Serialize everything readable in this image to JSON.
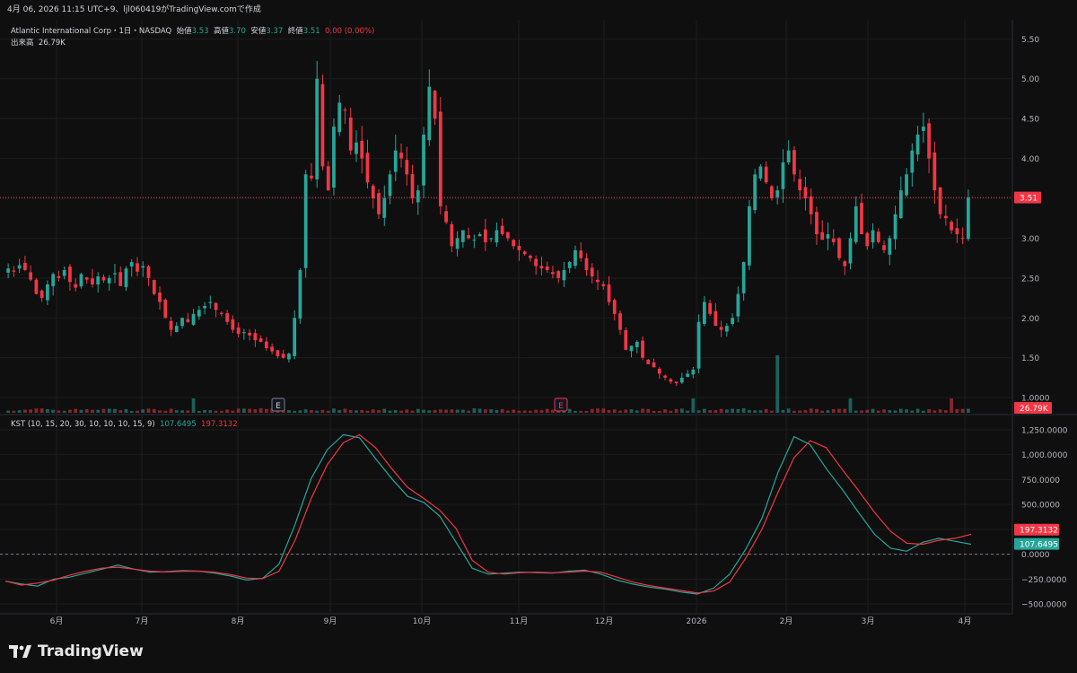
{
  "header": {
    "timestamp": "4月 06, 2026 11:15 UTC+9、ljl060419がTradingView.comで作成"
  },
  "legend": {
    "symbol": "Atlantic International Corp・1日・NASDAQ",
    "open_label": "始値",
    "open": "3.53",
    "high_label": "高値",
    "high": "3.70",
    "low_label": "安値",
    "low": "3.37",
    "close_label": "終値",
    "close": "3.51",
    "change": "0.00 (0.00%)",
    "volume_label": "出来高",
    "volume": "26.79K"
  },
  "kst": {
    "label": "KST (10, 15, 20, 30, 10, 10, 10, 15, 9)",
    "kst_value": "107.6495",
    "signal_value": "197.3132"
  },
  "colors": {
    "up": "#26a69a",
    "down": "#f23645",
    "kst_line": "#26a69a",
    "signal_line": "#f23645",
    "background": "#0f0f0f",
    "grid": "#1c1c1c"
  },
  "price_axis": {
    "ticks": [
      "5.50",
      "5.00",
      "4.50",
      "4.00",
      "3.50",
      "3.00",
      "2.50",
      "2.00",
      "1.50",
      "1.0000"
    ],
    "values": [
      5.5,
      5.0,
      4.5,
      4.0,
      3.5,
      3.0,
      2.5,
      2.0,
      1.5,
      1.0
    ],
    "last_price_badge": "3.51",
    "volume_badge": "26.79K"
  },
  "kst_axis": {
    "ticks": [
      "1,250.0000",
      "1,000.0000",
      "750.0000",
      "500.0000",
      "250.0000",
      "0.0000",
      "−250.0000",
      "−500.0000"
    ],
    "values": [
      1250,
      1000,
      750,
      500,
      250,
      0,
      -250,
      -500
    ],
    "signal_badge": "197.3132",
    "kst_badge": "107.6495"
  },
  "time_axis": {
    "labels": [
      "6月",
      "7月",
      "8月",
      "9月",
      "10月",
      "11月",
      "12月",
      "2026",
      "2月",
      "3月",
      "4月"
    ]
  },
  "events": [
    "E",
    "E"
  ],
  "footer": {
    "brand": "TradingView"
  },
  "chart_data": [
    {
      "type": "candlestick",
      "title": "Atlantic International Corp・1日・NASDAQ",
      "ylim": [
        0.9,
        5.65
      ],
      "close_series": [
        2.62,
        2.58,
        2.66,
        2.6,
        2.48,
        2.3,
        2.25,
        2.42,
        2.55,
        2.5,
        2.6,
        2.45,
        2.38,
        2.55,
        2.48,
        2.42,
        2.52,
        2.47,
        2.5,
        2.56,
        2.4,
        2.62,
        2.7,
        2.58,
        2.65,
        2.5,
        2.3,
        2.2,
        2.0,
        1.85,
        1.9,
        2.0,
        1.95,
        2.05,
        2.1,
        2.15,
        2.2,
        2.1,
        2.05,
        1.95,
        1.85,
        1.8,
        1.82,
        1.78,
        1.72,
        1.7,
        1.62,
        1.58,
        1.52,
        1.5,
        1.55,
        2.0,
        2.6,
        3.8,
        3.75,
        5.0,
        3.9,
        3.6,
        4.4,
        4.7,
        4.6,
        4.1,
        4.2,
        4.0,
        3.7,
        3.5,
        3.3,
        3.5,
        3.8,
        4.1,
        4.0,
        3.8,
        3.5,
        3.6,
        4.3,
        4.9,
        4.5,
        3.4,
        3.2,
        2.9,
        3.0,
        3.1,
        3.0,
        2.98,
        3.05,
        2.95,
        3.0,
        3.1,
        3.05,
        3.0,
        2.9,
        2.85,
        2.8,
        2.75,
        2.65,
        2.62,
        2.6,
        2.55,
        2.5,
        2.6,
        2.7,
        2.85,
        2.75,
        2.6,
        2.52,
        2.45,
        2.4,
        2.2,
        2.05,
        1.85,
        1.6,
        1.65,
        1.7,
        1.5,
        1.42,
        1.38,
        1.3,
        1.25,
        1.2,
        1.18,
        1.25,
        1.3,
        1.35,
        1.95,
        2.2,
        2.05,
        1.9,
        1.85,
        1.9,
        2.0,
        2.3,
        2.7,
        3.4,
        3.8,
        3.9,
        3.7,
        3.5,
        3.6,
        3.95,
        4.1,
        3.8,
        3.6,
        3.5,
        3.3,
        3.05,
        2.98,
        3.05,
        2.95,
        2.75,
        2.65,
        3.0,
        3.4,
        3.05,
        2.9,
        3.1,
        2.95,
        2.85,
        3.0,
        3.3,
        3.6,
        3.8,
        4.1,
        4.3,
        4.4,
        4.0,
        3.6,
        3.3,
        3.25,
        3.1,
        3.05,
        3.0,
        3.51
      ]
    },
    {
      "type": "line",
      "title": "KST (10, 15, 20, 30, 10, 10, 10, 15, 9)",
      "ylim": [
        -580,
        1330
      ],
      "series": [
        {
          "name": "KST",
          "values": [
            -270,
            -300,
            -320,
            -250,
            -230,
            -190,
            -150,
            -110,
            -150,
            -180,
            -175,
            -165,
            -170,
            -190,
            -220,
            -260,
            -240,
            -100,
            300,
            760,
            1050,
            1200,
            1170,
            960,
            760,
            580,
            520,
            380,
            120,
            -140,
            -200,
            -190,
            -180,
            -185,
            -190,
            -170,
            -160,
            -200,
            -260,
            -300,
            -330,
            -350,
            -380,
            -400,
            -340,
            -200,
            50,
            360,
            820,
            1180,
            1100,
            860,
            650,
            420,
            200,
            60,
            30,
            120,
            160,
            130,
            100
          ]
        },
        {
          "name": "Signal",
          "values": [
            -270,
            -310,
            -290,
            -260,
            -210,
            -170,
            -140,
            -130,
            -150,
            -170,
            -178,
            -172,
            -170,
            -180,
            -205,
            -240,
            -245,
            -170,
            140,
            560,
            900,
            1120,
            1200,
            1070,
            860,
            670,
            560,
            440,
            260,
            -60,
            -180,
            -200,
            -185,
            -180,
            -186,
            -180,
            -170,
            -180,
            -230,
            -280,
            -315,
            -340,
            -365,
            -390,
            -370,
            -280,
            -40,
            250,
            620,
            970,
            1140,
            1070,
            850,
            640,
            420,
            230,
            110,
            100,
            140,
            160,
            200
          ]
        }
      ]
    }
  ]
}
